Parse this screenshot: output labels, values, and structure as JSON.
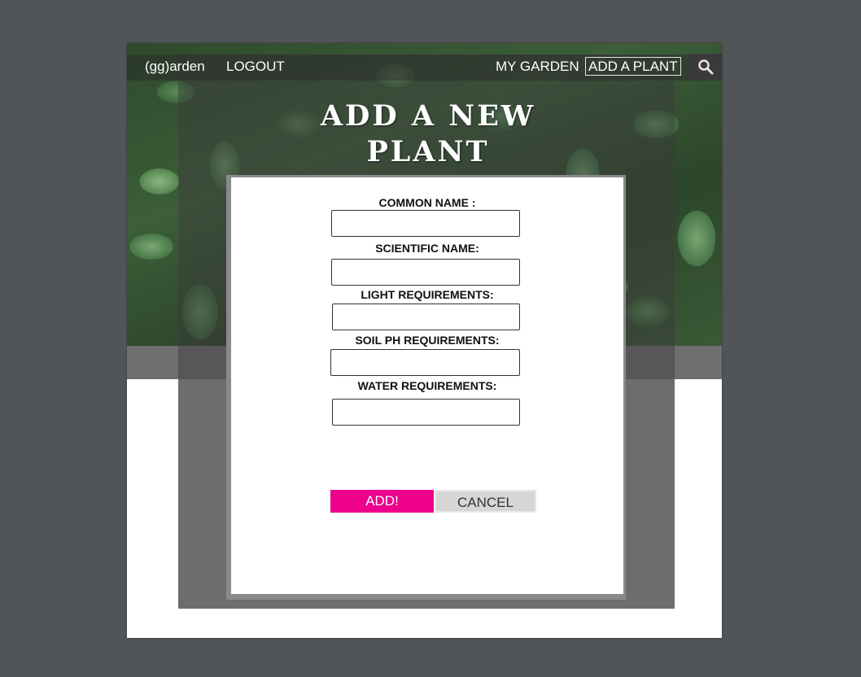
{
  "nav": {
    "brand": "(gg)arden",
    "logout": "LOGOUT",
    "my_garden": "MY GARDEN",
    "add_plant": "ADD A PLANT",
    "search_icon": "search-icon"
  },
  "page": {
    "title_line1": "ADD A NEW",
    "title_line2": "PLANT"
  },
  "form": {
    "common_name_label": "COMMON NAME :",
    "common_name_value": "",
    "scientific_name_label": "SCIENTIFIC NAME:",
    "scientific_name_value": "",
    "light_label": "LIGHT REQUIREMENTS:",
    "light_value": "",
    "soil_label": "SOIL PH REQUIREMENTS:",
    "soil_value": "",
    "water_label": "WATER REQUIREMENTS:",
    "water_value": "",
    "add_button": "ADD!",
    "cancel_button": "CANCEL"
  },
  "colors": {
    "accent": "#ec008c",
    "background": "#525558"
  }
}
